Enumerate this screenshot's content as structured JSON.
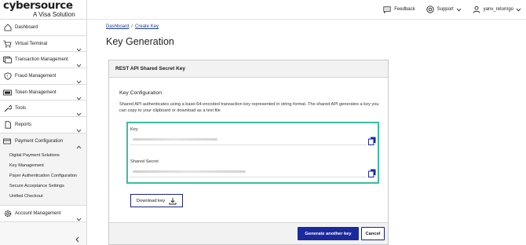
{
  "brand": {
    "name": "cybersource",
    "tagline": "A Visa Solution"
  },
  "sidebar": {
    "items": [
      {
        "label": "Dashboard",
        "icon": "home-icon"
      },
      {
        "label": "Virtual Terminal",
        "icon": "cart-icon"
      },
      {
        "label": "Transaction Management",
        "icon": "transaction-icon"
      },
      {
        "label": "Fraud Management",
        "icon": "shield-icon"
      },
      {
        "label": "Token Management",
        "icon": "token-icon"
      },
      {
        "label": "Tools",
        "icon": "wrench-icon"
      },
      {
        "label": "Reports",
        "icon": "report-icon"
      },
      {
        "label": "Payment Configuration",
        "icon": "payment-config-icon"
      },
      {
        "label": "Account Management",
        "icon": "gear-icon"
      }
    ],
    "payment_config_sub": [
      "Digital Payment Solutions",
      "Key Management",
      "Payer Authentication Configuration",
      "Secure Acceptance Settings",
      "Unified Checkout"
    ]
  },
  "topbar": {
    "feedback": "Feedback",
    "support": "Support",
    "user": "yanv_returngo"
  },
  "breadcrumb": {
    "home": "Dashboard",
    "separator": "/",
    "current": "Create Key"
  },
  "page": {
    "title": "Key Generation"
  },
  "card": {
    "title": "REST API Shared Secret Key",
    "section_title": "Key Configuration",
    "description": "Shared API authenticates using a base-64-encoded transaction key represented in string format. The shared API generates a key you can copy to your clipboard or download as a text file",
    "key_label": "Key",
    "secret_label": "Shared Secret",
    "download_label": "Download key",
    "generate_label": "Generate another key",
    "cancel_label": "Cancel"
  },
  "colors": {
    "accent": "#1a2a9e",
    "highlight": "#3bbca3"
  }
}
